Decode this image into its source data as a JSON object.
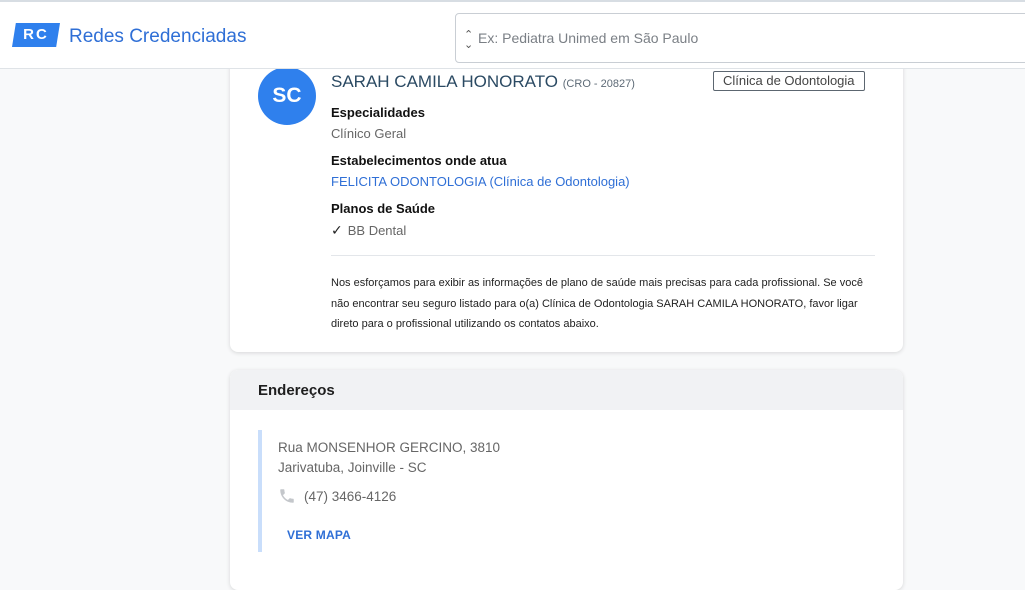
{
  "header": {
    "logo_text": "RC",
    "brand_name": "Redes Credenciadas",
    "search_placeholder": "Ex: Pediatra Unimed em São Paulo"
  },
  "profile": {
    "initials": "SC",
    "name": "SARAH CAMILA HONORATO",
    "registration": "(CRO - 20827)",
    "type_badge": "Clínica de Odontologia",
    "specialties_label": "Especialidades",
    "specialty": "Clínico Geral",
    "establishments_label": "Estabelecimentos onde atua",
    "establishment": "FELICITA ODONTOLOGIA (Clínica de Odontologia)",
    "plans_label": "Planos de Saúde",
    "plan": "BB Dental",
    "disclaimer": "Nos esforçamos para exibir as informações de plano de saúde mais precisas para cada profissional. Se você não encontrar seu seguro listado para o(a) Clínica de Odontologia SARAH CAMILA HONORATO, favor ligar direto para o profissional utilizando os contatos abaixo."
  },
  "addresses": {
    "title": "Endereços",
    "items": [
      {
        "street": "Rua MONSENHOR GERCINO, 3810",
        "city": "Jarivatuba, Joinville - SC",
        "phone": "(47) 3466-4126",
        "map_label": "VER MAPA"
      }
    ]
  },
  "colors": {
    "accent": "#2f80ed",
    "link": "#2f6fd6",
    "address_bar": "#c9defb"
  },
  "icons": {
    "sort": "sort-caret-icon",
    "check": "check-icon",
    "phone": "phone-icon"
  }
}
